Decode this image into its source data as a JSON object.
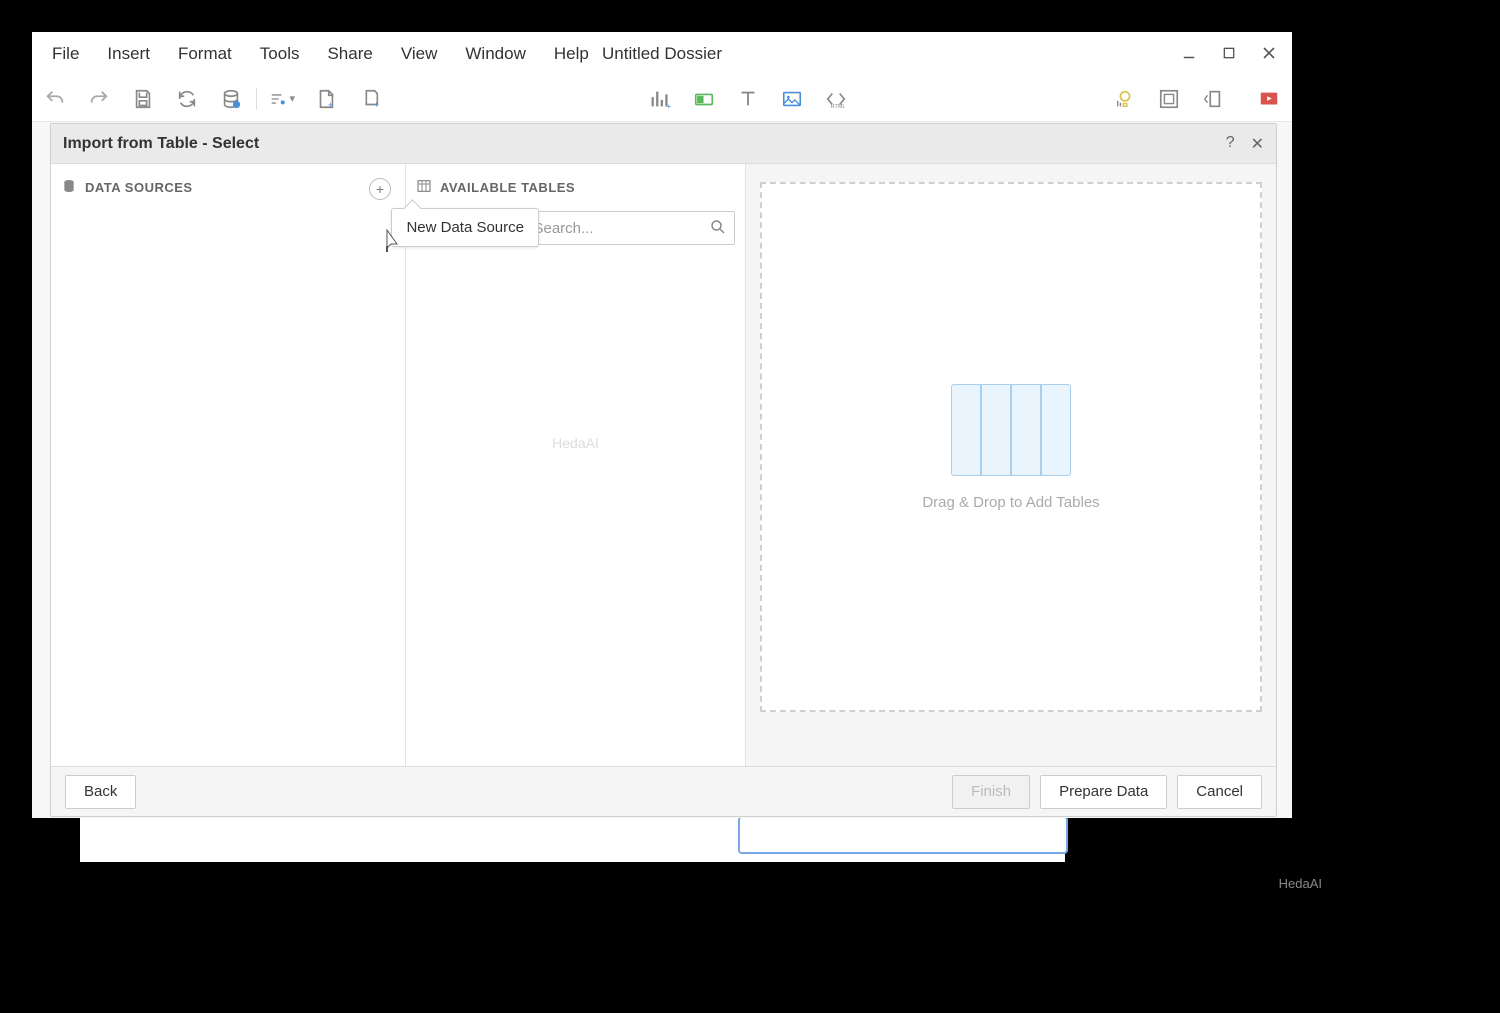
{
  "menu": {
    "items": [
      "File",
      "Insert",
      "Format",
      "Tools",
      "Share",
      "View",
      "Window",
      "Help"
    ]
  },
  "window": {
    "title": "Untitled Dossier"
  },
  "dialog": {
    "title": "Import from Table - Select",
    "dataSourcesLabel": "DATA SOURCES",
    "availableTablesLabel": "AVAILABLE TABLES",
    "tooltip": "New Data Source",
    "searchPlaceholder": "Search...",
    "dropzoneText": "Drag & Drop to Add Tables",
    "buttons": {
      "back": "Back",
      "finish": "Finish",
      "prepare": "Prepare Data",
      "cancel": "Cancel"
    }
  },
  "watermark1": "HedaAI",
  "watermark2": "HedaAI"
}
